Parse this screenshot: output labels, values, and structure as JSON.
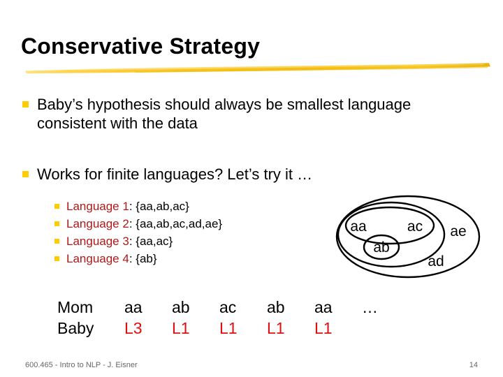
{
  "slide": {
    "title": "Conservative Strategy",
    "bullets": [
      {
        "text": "Baby’s hypothesis should always be smallest language consistent with the data"
      },
      {
        "text": "Works for finite languages?  Let’s try it …"
      }
    ],
    "sub_bullets": [
      {
        "name": "Language 1",
        "set": ": {aa,ab,ac}"
      },
      {
        "name": "Language 2",
        "set": ": {aa,ab,ac,ad,ae}"
      },
      {
        "name": "Language 3",
        "set": ": {aa,ac}"
      },
      {
        "name": "Language 4",
        "set": ": {ab}"
      }
    ],
    "diagram": {
      "labels": {
        "aa": "aa",
        "ac": "ac",
        "ab": "ab",
        "ad": "ad",
        "ae": "ae"
      }
    },
    "table": {
      "row_mom_label": "Mom",
      "row_baby_label": "Baby",
      "mom": [
        "aa",
        "ab",
        "ac",
        "ab",
        "aa",
        "…"
      ],
      "baby": [
        "L3",
        "L1",
        "L1",
        "L1",
        "L1",
        ""
      ]
    },
    "footer": {
      "left": "600.465 - Intro to NLP - J. Eisner",
      "right": "14"
    },
    "colors": {
      "bullet_square": "#FFCC00",
      "language_label": "#B01818",
      "baby_value": "#E01010",
      "title": "#000000",
      "footer": "#666666",
      "brush": "#F5C518"
    }
  }
}
